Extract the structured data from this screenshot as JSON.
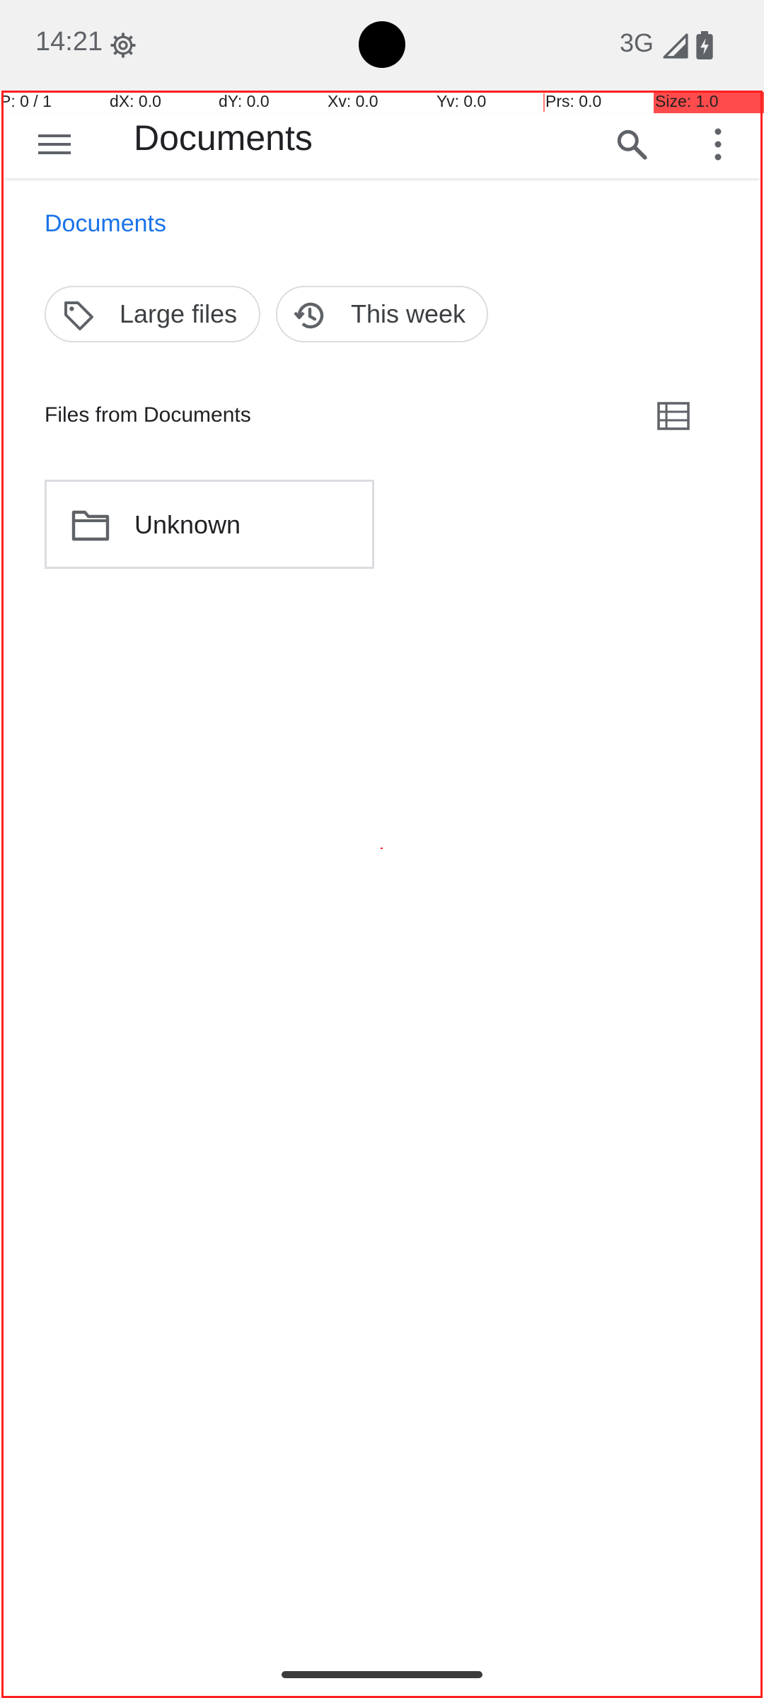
{
  "status_bar": {
    "time": "14:21",
    "network": "3G",
    "icons": [
      "settings-gear-icon",
      "signal-icon",
      "battery-charging-icon"
    ]
  },
  "pointer_overlay": {
    "p": "P: 0 / 1",
    "dx": "dX: 0.0",
    "dy": "dY: 0.0",
    "xv": "Xv: 0.0",
    "yv": "Yv: 0.0",
    "prs": "Prs: 0.0",
    "size": "Size: 1.0"
  },
  "app_bar": {
    "title": "Documents",
    "icons": [
      "menu-icon",
      "search-icon",
      "more-vert-icon"
    ]
  },
  "breadcrumb": "Documents",
  "chips": [
    {
      "label": "Large files",
      "icon": "label-tag-icon"
    },
    {
      "label": "This week",
      "icon": "history-icon"
    }
  ],
  "section": {
    "title": "Files from Documents",
    "view_icon": "list-view-icon"
  },
  "items": [
    {
      "label": "Unknown",
      "icon": "folder-icon"
    }
  ],
  "colors": {
    "accent": "#1a73e8",
    "overlay_border": "#ff2020",
    "status_bar_bg": "#f1f1f1"
  }
}
